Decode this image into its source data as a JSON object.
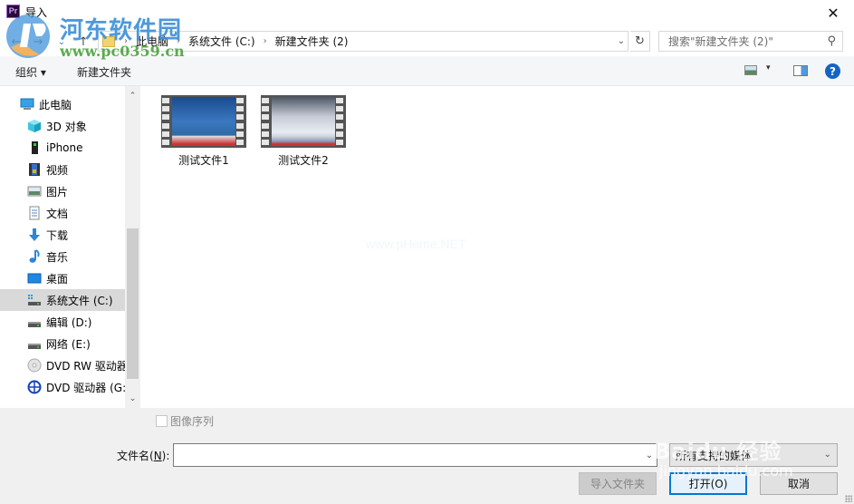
{
  "window": {
    "app_icon_label": "Pr",
    "title": "导入",
    "close_glyph": "✕"
  },
  "watermarks": {
    "site_name": "河东软件园",
    "site_url": "www.pc0359.cn",
    "faint_text": "www.pHome.NET",
    "baidu_title": "Baidu 经验",
    "baidu_url": "jingyan.baidu.com"
  },
  "navigation": {
    "back_glyph": "←",
    "forward_glyph": "→",
    "recent_glyph": "⌄",
    "up_glyph": "↑",
    "breadcrumb": [
      "此电脑",
      "系统文件 (C:)",
      "新建文件夹 (2)"
    ],
    "breadcrumb_sep": "›",
    "dropdown_glyph": "⌄",
    "refresh_glyph": "↻",
    "search_placeholder": "搜索\"新建文件夹 (2)\"",
    "search_glyph": "⚲"
  },
  "toolbar": {
    "organize_label": "组织 ▾",
    "new_folder_label": "新建文件夹",
    "view_dropdown_glyph": "▾",
    "help_glyph": "?"
  },
  "sidebar": {
    "items": [
      {
        "label": "此电脑",
        "icon": "computer-icon",
        "level": 0
      },
      {
        "label": "3D 对象",
        "icon": "3d-objects-icon",
        "level": 1
      },
      {
        "label": "iPhone",
        "icon": "phone-icon",
        "level": 1
      },
      {
        "label": "视频",
        "icon": "video-icon",
        "level": 1
      },
      {
        "label": "图片",
        "icon": "pictures-icon",
        "level": 1
      },
      {
        "label": "文档",
        "icon": "documents-icon",
        "level": 1
      },
      {
        "label": "下载",
        "icon": "download-icon",
        "level": 1
      },
      {
        "label": "音乐",
        "icon": "music-icon",
        "level": 1
      },
      {
        "label": "桌面",
        "icon": "desktop-icon",
        "level": 1
      },
      {
        "label": "系统文件 (C:)",
        "icon": "system-drive-icon",
        "level": 1,
        "selected": true
      },
      {
        "label": "编辑 (D:)",
        "icon": "drive-icon",
        "level": 1
      },
      {
        "label": "网络 (E:)",
        "icon": "drive-icon",
        "level": 1
      },
      {
        "label": "DVD RW 驱动器",
        "icon": "dvd-rw-icon",
        "level": 1
      },
      {
        "label": "DVD 驱动器 (G:",
        "icon": "dvd-drive-icon",
        "level": 1
      }
    ],
    "scroll_up_glyph": "⌃",
    "scroll_down_glyph": "⌄"
  },
  "files": [
    {
      "name": "测试文件1",
      "type": "video"
    },
    {
      "name": "测试文件2",
      "type": "video"
    }
  ],
  "footer": {
    "image_sequence_label": "图像序列",
    "image_sequence_checked": false,
    "filename_label_prefix": "文件名(",
    "filename_label_key": "N",
    "filename_label_suffix": "):",
    "filename_value": "",
    "filename_dropdown_glyph": "⌄",
    "filetype_value": "所有支持的媒体",
    "filetype_dropdown_glyph": "⌄",
    "import_folder_label": "导入文件夹",
    "open_label": "打开(O)",
    "cancel_label": "取消"
  }
}
